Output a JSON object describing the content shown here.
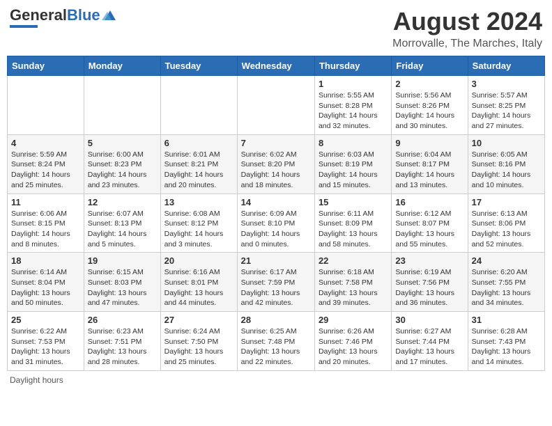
{
  "header": {
    "logo_line1": "General",
    "logo_line2": "Blue",
    "title": "August 2024",
    "subtitle": "Morrovalle, The Marches, Italy"
  },
  "footer": {
    "note": "Daylight hours"
  },
  "weekdays": [
    "Sunday",
    "Monday",
    "Tuesday",
    "Wednesday",
    "Thursday",
    "Friday",
    "Saturday"
  ],
  "weeks": [
    [
      {
        "day": "",
        "info": ""
      },
      {
        "day": "",
        "info": ""
      },
      {
        "day": "",
        "info": ""
      },
      {
        "day": "",
        "info": ""
      },
      {
        "day": "1",
        "info": "Sunrise: 5:55 AM\nSunset: 8:28 PM\nDaylight: 14 hours\nand 32 minutes."
      },
      {
        "day": "2",
        "info": "Sunrise: 5:56 AM\nSunset: 8:26 PM\nDaylight: 14 hours\nand 30 minutes."
      },
      {
        "day": "3",
        "info": "Sunrise: 5:57 AM\nSunset: 8:25 PM\nDaylight: 14 hours\nand 27 minutes."
      }
    ],
    [
      {
        "day": "4",
        "info": "Sunrise: 5:59 AM\nSunset: 8:24 PM\nDaylight: 14 hours\nand 25 minutes."
      },
      {
        "day": "5",
        "info": "Sunrise: 6:00 AM\nSunset: 8:23 PM\nDaylight: 14 hours\nand 23 minutes."
      },
      {
        "day": "6",
        "info": "Sunrise: 6:01 AM\nSunset: 8:21 PM\nDaylight: 14 hours\nand 20 minutes."
      },
      {
        "day": "7",
        "info": "Sunrise: 6:02 AM\nSunset: 8:20 PM\nDaylight: 14 hours\nand 18 minutes."
      },
      {
        "day": "8",
        "info": "Sunrise: 6:03 AM\nSunset: 8:19 PM\nDaylight: 14 hours\nand 15 minutes."
      },
      {
        "day": "9",
        "info": "Sunrise: 6:04 AM\nSunset: 8:17 PM\nDaylight: 14 hours\nand 13 minutes."
      },
      {
        "day": "10",
        "info": "Sunrise: 6:05 AM\nSunset: 8:16 PM\nDaylight: 14 hours\nand 10 minutes."
      }
    ],
    [
      {
        "day": "11",
        "info": "Sunrise: 6:06 AM\nSunset: 8:15 PM\nDaylight: 14 hours\nand 8 minutes."
      },
      {
        "day": "12",
        "info": "Sunrise: 6:07 AM\nSunset: 8:13 PM\nDaylight: 14 hours\nand 5 minutes."
      },
      {
        "day": "13",
        "info": "Sunrise: 6:08 AM\nSunset: 8:12 PM\nDaylight: 14 hours\nand 3 minutes."
      },
      {
        "day": "14",
        "info": "Sunrise: 6:09 AM\nSunset: 8:10 PM\nDaylight: 14 hours\nand 0 minutes."
      },
      {
        "day": "15",
        "info": "Sunrise: 6:11 AM\nSunset: 8:09 PM\nDaylight: 13 hours\nand 58 minutes."
      },
      {
        "day": "16",
        "info": "Sunrise: 6:12 AM\nSunset: 8:07 PM\nDaylight: 13 hours\nand 55 minutes."
      },
      {
        "day": "17",
        "info": "Sunrise: 6:13 AM\nSunset: 8:06 PM\nDaylight: 13 hours\nand 52 minutes."
      }
    ],
    [
      {
        "day": "18",
        "info": "Sunrise: 6:14 AM\nSunset: 8:04 PM\nDaylight: 13 hours\nand 50 minutes."
      },
      {
        "day": "19",
        "info": "Sunrise: 6:15 AM\nSunset: 8:03 PM\nDaylight: 13 hours\nand 47 minutes."
      },
      {
        "day": "20",
        "info": "Sunrise: 6:16 AM\nSunset: 8:01 PM\nDaylight: 13 hours\nand 44 minutes."
      },
      {
        "day": "21",
        "info": "Sunrise: 6:17 AM\nSunset: 7:59 PM\nDaylight: 13 hours\nand 42 minutes."
      },
      {
        "day": "22",
        "info": "Sunrise: 6:18 AM\nSunset: 7:58 PM\nDaylight: 13 hours\nand 39 minutes."
      },
      {
        "day": "23",
        "info": "Sunrise: 6:19 AM\nSunset: 7:56 PM\nDaylight: 13 hours\nand 36 minutes."
      },
      {
        "day": "24",
        "info": "Sunrise: 6:20 AM\nSunset: 7:55 PM\nDaylight: 13 hours\nand 34 minutes."
      }
    ],
    [
      {
        "day": "25",
        "info": "Sunrise: 6:22 AM\nSunset: 7:53 PM\nDaylight: 13 hours\nand 31 minutes."
      },
      {
        "day": "26",
        "info": "Sunrise: 6:23 AM\nSunset: 7:51 PM\nDaylight: 13 hours\nand 28 minutes."
      },
      {
        "day": "27",
        "info": "Sunrise: 6:24 AM\nSunset: 7:50 PM\nDaylight: 13 hours\nand 25 minutes."
      },
      {
        "day": "28",
        "info": "Sunrise: 6:25 AM\nSunset: 7:48 PM\nDaylight: 13 hours\nand 22 minutes."
      },
      {
        "day": "29",
        "info": "Sunrise: 6:26 AM\nSunset: 7:46 PM\nDaylight: 13 hours\nand 20 minutes."
      },
      {
        "day": "30",
        "info": "Sunrise: 6:27 AM\nSunset: 7:44 PM\nDaylight: 13 hours\nand 17 minutes."
      },
      {
        "day": "31",
        "info": "Sunrise: 6:28 AM\nSunset: 7:43 PM\nDaylight: 13 hours\nand 14 minutes."
      }
    ]
  ]
}
